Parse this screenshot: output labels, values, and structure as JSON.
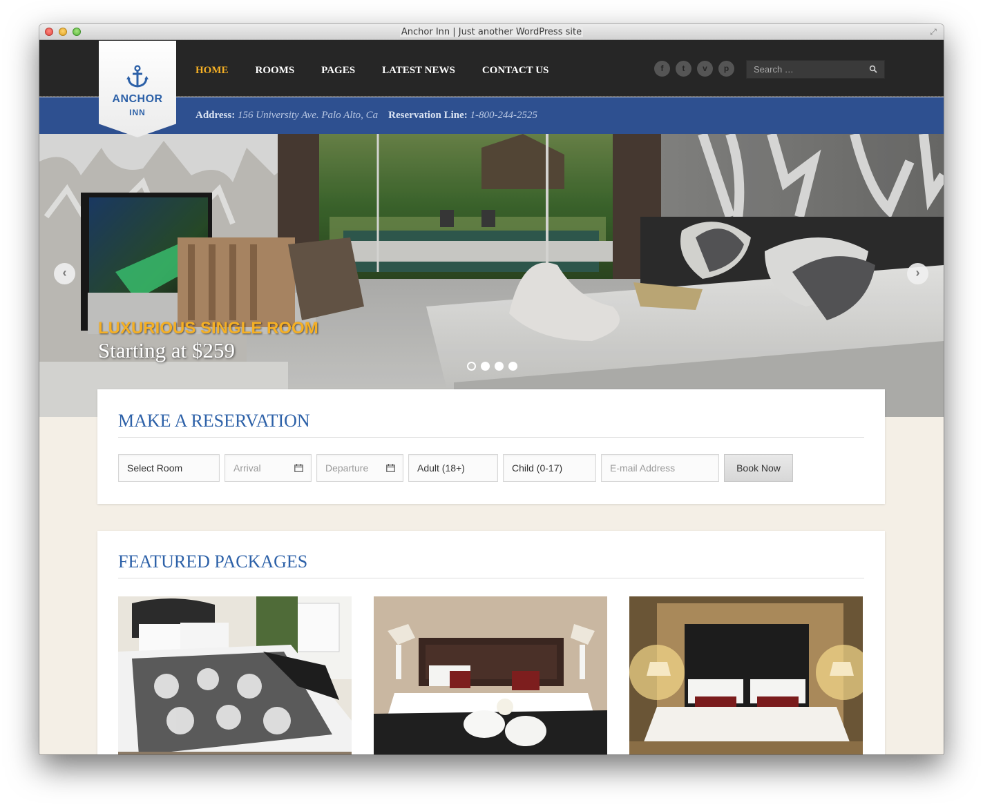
{
  "window": {
    "title": "Anchor Inn | Just another WordPress site"
  },
  "logo": {
    "name": "ANCHOR",
    "sub": "INN"
  },
  "nav": {
    "items": [
      {
        "label": "HOME",
        "active": true
      },
      {
        "label": "ROOMS"
      },
      {
        "label": "PAGES"
      },
      {
        "label": "LATEST NEWS"
      },
      {
        "label": "CONTACT US"
      }
    ]
  },
  "social": [
    {
      "icon": "facebook-icon",
      "glyph": "f"
    },
    {
      "icon": "twitter-icon",
      "glyph": "t"
    },
    {
      "icon": "vimeo-icon",
      "glyph": "v"
    },
    {
      "icon": "pinterest-icon",
      "glyph": "p"
    }
  ],
  "search": {
    "placeholder": "Search …"
  },
  "info": {
    "address_label": "Address:",
    "address": "156 University Ave. Palo Alto, Ca",
    "reservation_label": "Reservation Line:",
    "phone": "1-800-244-2525"
  },
  "hero": {
    "title": "LUXURIOUS SINGLE ROOM",
    "subtitle": "Starting at $259",
    "slide_count": 4,
    "active_slide": 1
  },
  "reservation": {
    "title": "MAKE A RESERVATION",
    "room": "Select Room",
    "arrival_placeholder": "Arrival",
    "departure_placeholder": "Departure",
    "adult": "Adult (18+)",
    "child": "Child (0-17)",
    "email_placeholder": "E-mail Address",
    "book_label": "Book Now"
  },
  "featured": {
    "title": "FEATURED PACKAGES"
  },
  "colors": {
    "accent": "#f5b025",
    "brand_blue": "#2d61a8",
    "info_bar": "#2e5090",
    "header": "#262626",
    "page_bg": "#f4efe6"
  }
}
